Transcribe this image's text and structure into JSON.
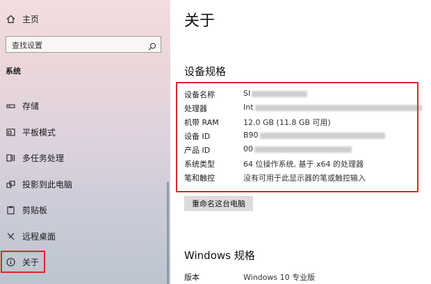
{
  "sidebar": {
    "home_label": "主页",
    "search_placeholder": "查找设置",
    "section_label": "系统",
    "items": [
      {
        "label": "存储",
        "icon": "storage-icon"
      },
      {
        "label": "平板模式",
        "icon": "tablet-icon"
      },
      {
        "label": "多任务处理",
        "icon": "multitask-icon"
      },
      {
        "label": "投影到此电脑",
        "icon": "project-icon"
      },
      {
        "label": "剪贴板",
        "icon": "clipboard-icon"
      },
      {
        "label": "远程桌面",
        "icon": "remote-icon"
      },
      {
        "label": "关于",
        "icon": "info-icon",
        "active": true
      }
    ]
  },
  "main": {
    "title": "关于",
    "device_heading": "设备规格",
    "specs": [
      {
        "key": "设备名称",
        "value": "SI"
      },
      {
        "key": "处理器",
        "value": "Int"
      },
      {
        "key": "机带 RAM",
        "value": "12.0 GB (11.8 GB 可用)"
      },
      {
        "key": "设备 ID",
        "value": "B90"
      },
      {
        "key": "产品 ID",
        "value": "00"
      },
      {
        "key": "系统类型",
        "value": "64 位操作系统, 基于 x64 的处理器"
      },
      {
        "key": "笔和触控",
        "value": "没有可用于此显示器的笔或触控输入"
      }
    ],
    "rename_button": "重命名这台电脑",
    "windows_heading": "Windows 规格",
    "windows_specs": [
      {
        "key": "版本",
        "value": "Windows 10 专业版"
      }
    ]
  },
  "colors": {
    "highlight": "#d9262a",
    "button_bg": "#dcdcdc"
  }
}
